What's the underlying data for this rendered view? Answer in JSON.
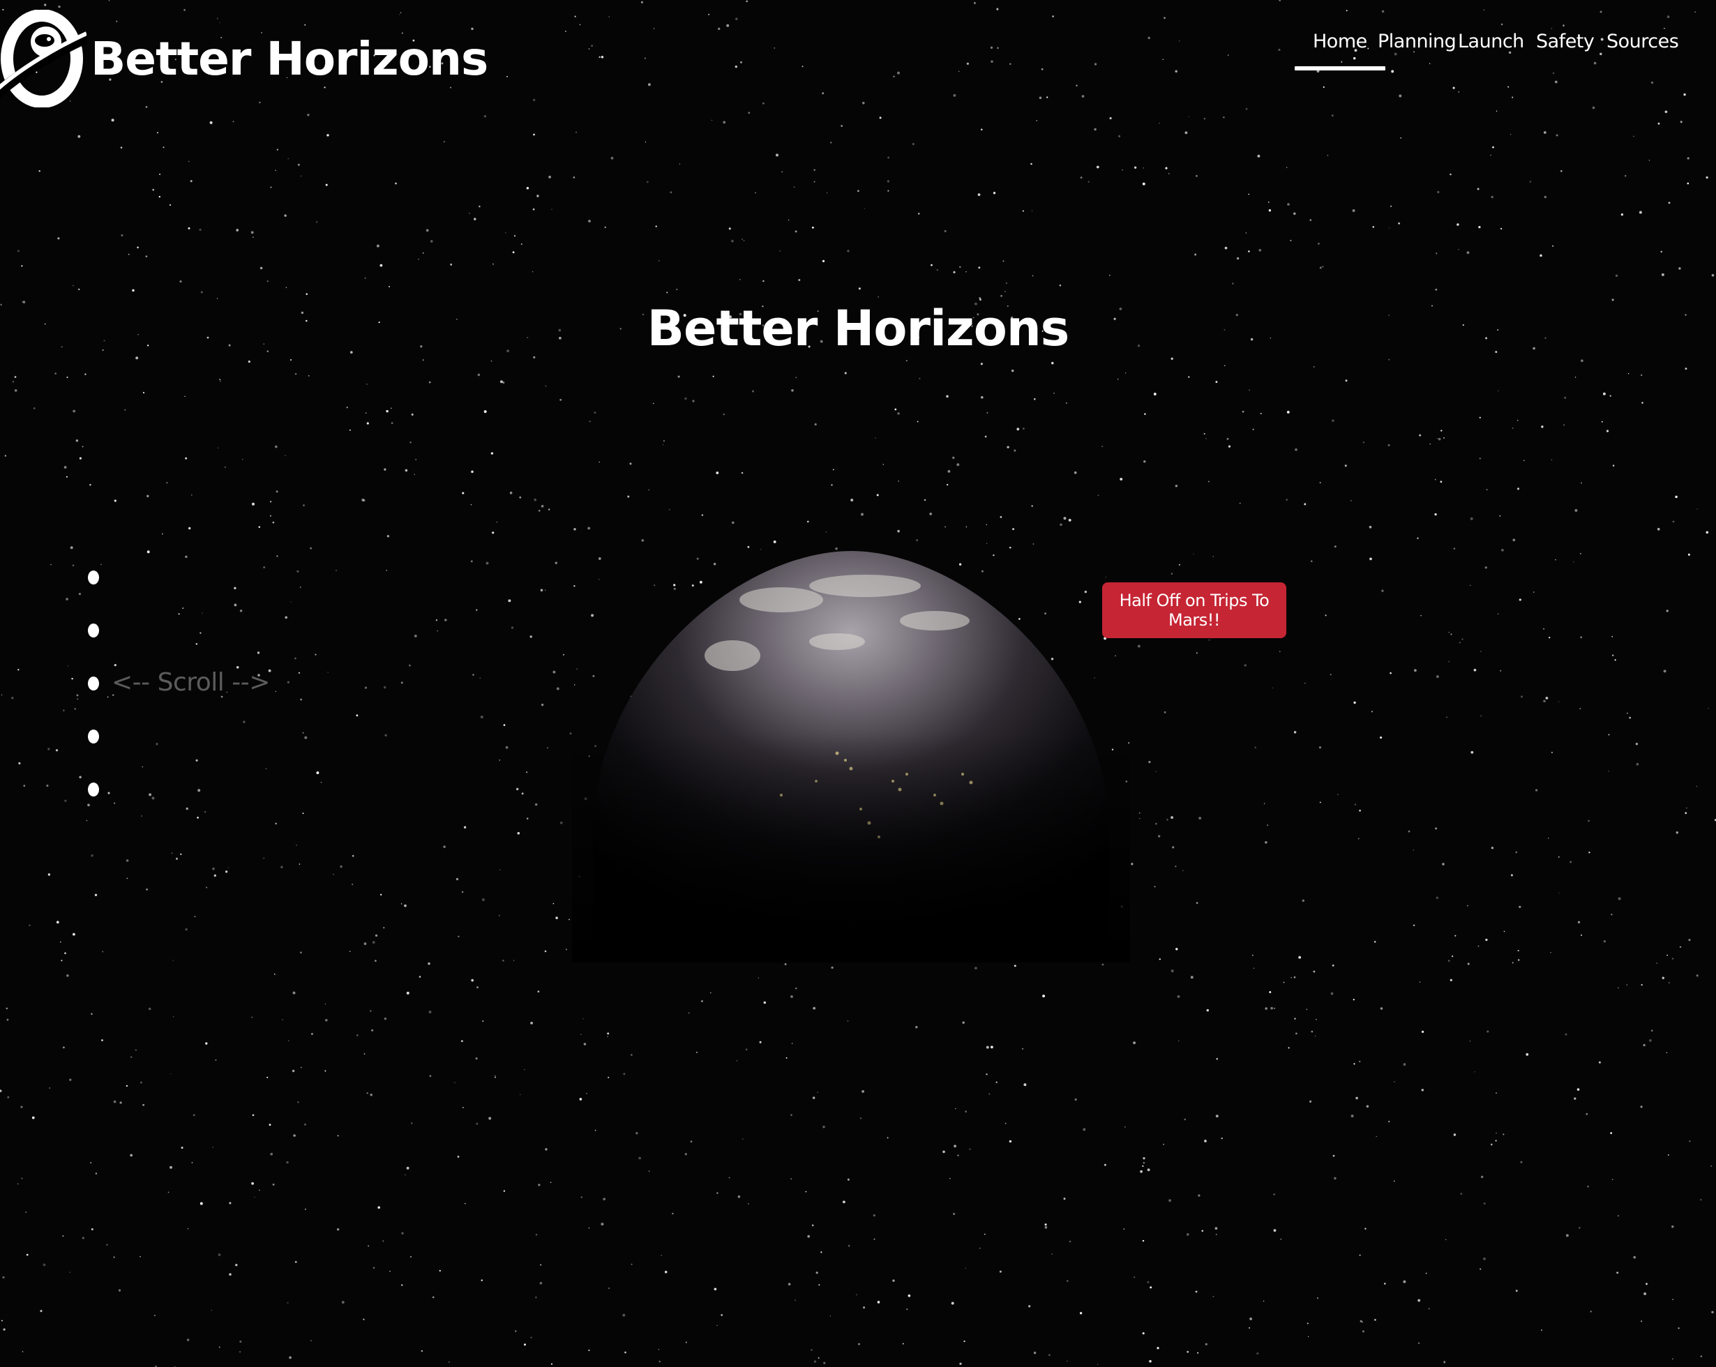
{
  "brand": {
    "name": "Better Horizons",
    "logo_icon": "astronaut-orbit-logo"
  },
  "nav": {
    "items": [
      {
        "label": "Home",
        "active": true
      },
      {
        "label": "Planning",
        "active": false
      },
      {
        "label": "Launch",
        "active": false
      },
      {
        "label": "Safety",
        "active": false
      },
      {
        "label": "Sources",
        "active": false
      }
    ]
  },
  "hero": {
    "title": "Better Horizons",
    "promo_label": "Half Off on Trips To Mars!!",
    "scroll_hint": "<-- Scroll -->"
  },
  "side_dots": {
    "count": 5
  },
  "colors": {
    "background": "#000000",
    "accent": "#c62534",
    "text": "#ffffff",
    "muted_text": "#5c5c5c"
  }
}
